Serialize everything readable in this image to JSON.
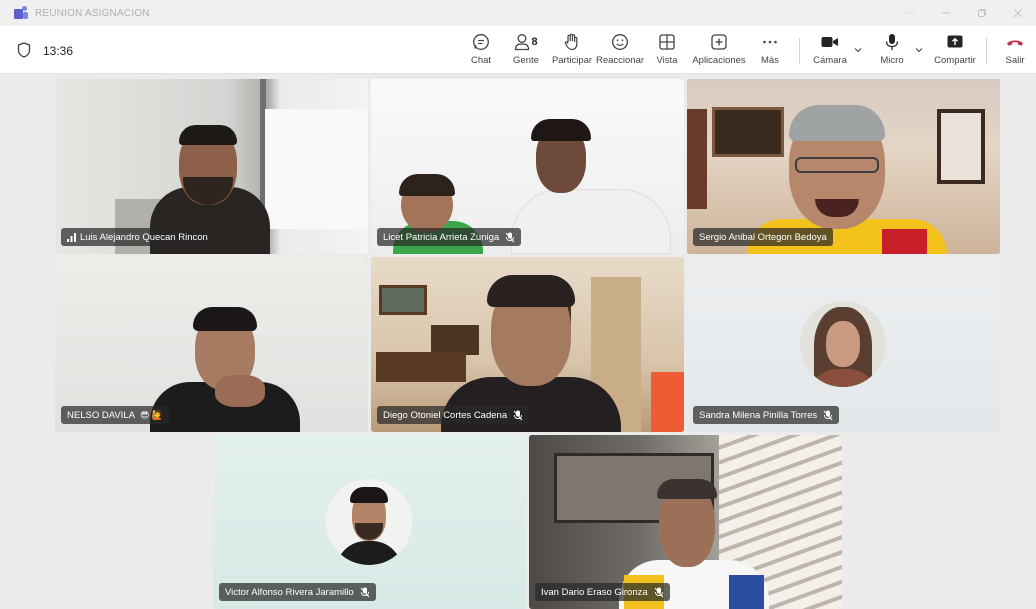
{
  "window": {
    "title": "REUNION ASIGNACION"
  },
  "toolbar": {
    "time": "13:36",
    "people_count": "8",
    "chat": "Chat",
    "people": "Gente",
    "raise": "Participar",
    "react": "Reaccionar",
    "view": "Vista",
    "apps": "Aplicaciones",
    "more": "Más",
    "camera": "Cámara",
    "mic": "Micro",
    "share": "Compartir",
    "leave": "Salir",
    "colors": {
      "leave_red": "#c4314b",
      "accent": "#6264c7"
    }
  },
  "participants": [
    {
      "name": "Luis Alejandro Quecan Rincon",
      "muted": false,
      "speaking": true,
      "active": false
    },
    {
      "name": "Licet Patricia Arrieta Zuniga",
      "muted": true,
      "active": false
    },
    {
      "name": "Sergio Anibal Ortegon Bedoya",
      "muted": false,
      "active": true
    },
    {
      "name": "NELSO DAVILA",
      "muted": false,
      "active": true,
      "emojis": "😎 🙋"
    },
    {
      "name": "Diego Otoniel Cortes Cadena",
      "muted": true,
      "active": false
    },
    {
      "name": "Sandra Milena Pinilla Torres",
      "muted": true,
      "active": false
    },
    {
      "name": "Victor Alfonso Rivera Jaramillo",
      "muted": true,
      "active": false
    },
    {
      "name": "Ivan Dario Eraso Gironza",
      "muted": true,
      "active": false
    }
  ]
}
